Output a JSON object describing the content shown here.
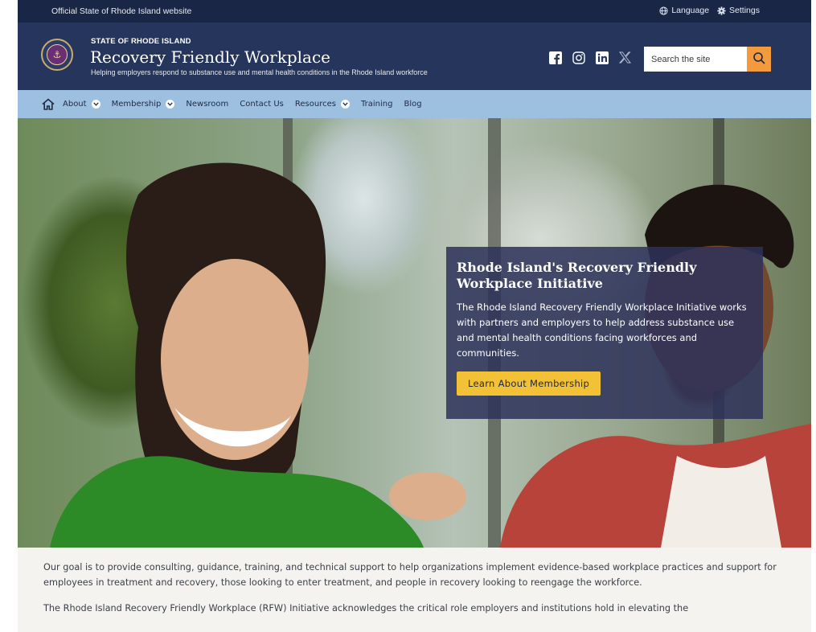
{
  "utility": {
    "official_text": "Official State of Rhode Island website",
    "language_label": "Language",
    "settings_label": "Settings"
  },
  "header": {
    "eyebrow": "STATE OF RHODE ISLAND",
    "title": "Recovery Friendly Workplace",
    "tagline": "Helping employers respond to substance use and mental health conditions in the Rhode Island workforce",
    "social_icons": [
      "facebook-icon",
      "instagram-icon",
      "linkedin-icon",
      "x-icon"
    ],
    "search_placeholder": "Search the site"
  },
  "nav": {
    "items": [
      {
        "label": "About",
        "dropdown": true
      },
      {
        "label": "Membership",
        "dropdown": true
      },
      {
        "label": "Newsroom",
        "dropdown": false
      },
      {
        "label": "Contact Us",
        "dropdown": false
      },
      {
        "label": "Resources",
        "dropdown": true
      },
      {
        "label": "Training",
        "dropdown": false
      },
      {
        "label": "Blog",
        "dropdown": false
      }
    ]
  },
  "hero": {
    "heading": "Rhode Island's Recovery Friendly Workplace Initiative",
    "body": "The Rhode Island Recovery Friendly Workplace Initiative works with partners and employers to help address substance use and mental health conditions facing workforces and communities.",
    "cta_label": "Learn About Membership"
  },
  "content": {
    "paragraph_1": "Our goal is to provide consulting, guidance, training, and technical support to help organizations implement evidence-based workplace practices and support for employees in treatment and recovery, those looking to enter treatment, and people in recovery looking to reengage the workforce.",
    "paragraph_2": "The Rhode Island Recovery Friendly Workplace (RFW) Initiative acknowledges the critical role employers and institutions hold in elevating the"
  },
  "colors": {
    "utility_bg": "#1a2646",
    "header_bg": "#25355b",
    "nav_bg": "#9dbfe0",
    "search_button": "#f39a3c",
    "cta_bg": "#f2c136",
    "overlay_bg": "#2d325a"
  }
}
